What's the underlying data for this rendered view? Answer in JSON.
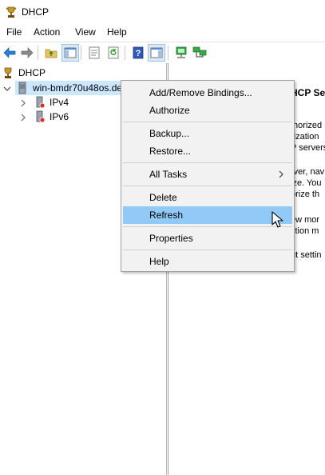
{
  "window": {
    "title": "DHCP"
  },
  "menubar": {
    "items": [
      "File",
      "Action",
      "View",
      "Help"
    ]
  },
  "toolbar": {
    "buttons": [
      "back-icon",
      "forward-icon",
      "up-folder-icon",
      "show-hide-tree-icon",
      "properties-icon",
      "refresh-icon",
      "help-icon",
      "show-action-pane-icon",
      "server-status-icon",
      "computer-network-icon"
    ]
  },
  "tree": {
    "root": "DHCP",
    "server": "win-bmdr70u48os.de",
    "children": [
      "IPv4",
      "IPv6"
    ]
  },
  "right_pane": {
    "heading": "HCP Se",
    "fragments": [
      "thorized",
      "rization",
      "P servers",
      "rver, nav",
      "ize. You",
      "orize th",
      "ew mor",
      "ction m",
      "ut settin"
    ]
  },
  "context_menu": {
    "items": {
      "bindings": "Add/Remove Bindings...",
      "authorize": "Authorize",
      "backup": "Backup...",
      "restore": "Restore...",
      "all_tasks": "All Tasks",
      "delete": "Delete",
      "refresh": "Refresh",
      "properties": "Properties",
      "help": "Help"
    },
    "highlighted": "Refresh"
  },
  "colors": {
    "highlight": "#91c9f7",
    "selection": "#cce8ff",
    "menu_bg": "#f2f2f2"
  }
}
